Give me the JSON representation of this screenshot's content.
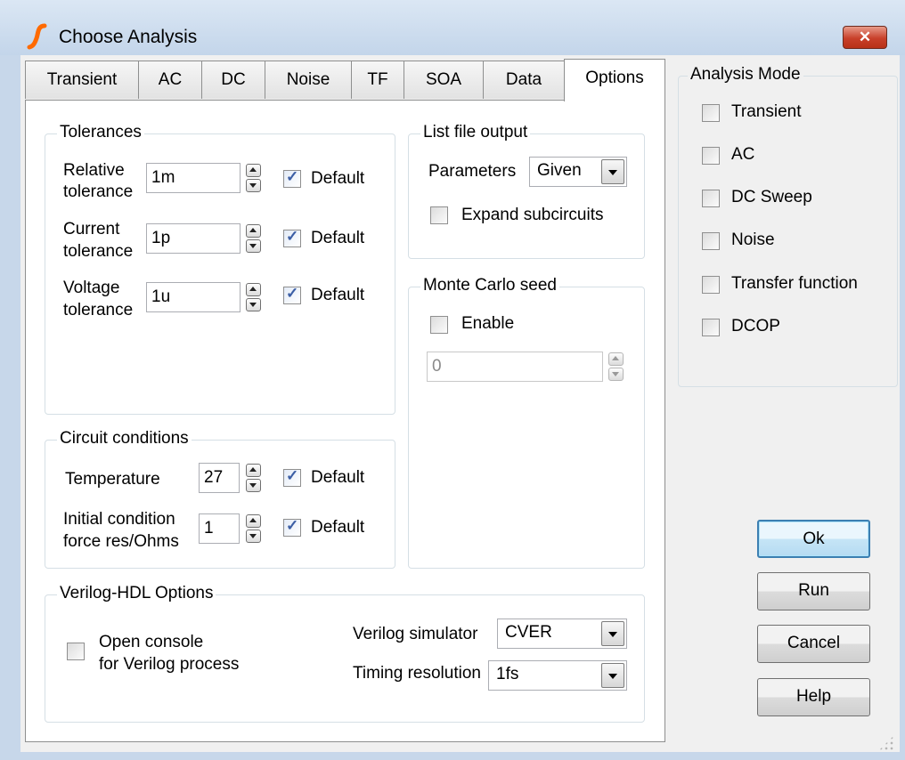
{
  "window": {
    "title": "Choose Analysis",
    "close_glyph": "✕"
  },
  "tabs": [
    {
      "label": "Transient"
    },
    {
      "label": "AC"
    },
    {
      "label": "DC"
    },
    {
      "label": "Noise"
    },
    {
      "label": "TF"
    },
    {
      "label": "SOA"
    },
    {
      "label": "Data"
    },
    {
      "label": "Options",
      "active": true
    }
  ],
  "tolerances": {
    "title": "Tolerances",
    "relative": {
      "label1": "Relative",
      "label2": "tolerance",
      "value": "1m",
      "default_label": "Default",
      "default_checked": true
    },
    "current": {
      "label1": "Current",
      "label2": "tolerance",
      "value": "1p",
      "default_label": "Default",
      "default_checked": true
    },
    "voltage": {
      "label1": "Voltage",
      "label2": "tolerance",
      "value": "1u",
      "default_label": "Default",
      "default_checked": true
    }
  },
  "list_file": {
    "title": "List file output",
    "parameters_label": "Parameters",
    "parameters_value": "Given",
    "expand_label": "Expand subcircuits",
    "expand_checked": false
  },
  "monte_carlo": {
    "title": "Monte Carlo seed",
    "enable_label": "Enable",
    "enable_checked": false,
    "seed_value": "0"
  },
  "circuit": {
    "title": "Circuit conditions",
    "temperature_label": "Temperature",
    "temperature_value": "27",
    "temperature_default_label": "Default",
    "ic_label1": "Initial condition",
    "ic_label2": "force res/Ohms",
    "ic_value": "1",
    "ic_default_label": "Default"
  },
  "verilog": {
    "title": "Verilog-HDL Options",
    "console_label1": "Open console",
    "console_label2": "for Verilog process",
    "console_checked": false,
    "simulator_label": "Verilog simulator",
    "simulator_value": "CVER",
    "timing_label": "Timing resolution",
    "timing_value": "1fs"
  },
  "analysis_mode": {
    "title": "Analysis Mode",
    "items": [
      {
        "label": "Transient",
        "checked": false
      },
      {
        "label": "AC",
        "checked": false
      },
      {
        "label": "DC Sweep",
        "checked": false
      },
      {
        "label": "Noise",
        "checked": false
      },
      {
        "label": "Transfer function",
        "checked": false
      },
      {
        "label": "DCOP",
        "checked": false
      }
    ]
  },
  "buttons": {
    "ok": "Ok",
    "run": "Run",
    "cancel": "Cancel",
    "help": "Help"
  },
  "colors": {
    "accent": "#3c7fb1",
    "check": "#3b5ea5",
    "close": "#c8402a",
    "logo": "#ff6a00"
  }
}
